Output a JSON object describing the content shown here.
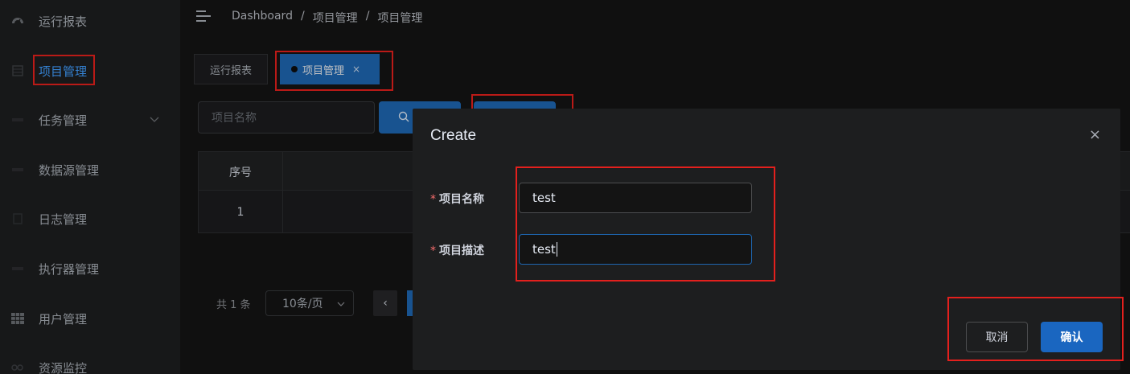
{
  "sidebar": {
    "items": [
      {
        "label": "运行报表",
        "icon": "dashboard-icon"
      },
      {
        "label": "项目管理",
        "icon": "project-icon"
      },
      {
        "label": "任务管理",
        "icon": "task-icon"
      },
      {
        "label": "数据源管理",
        "icon": "database-icon"
      },
      {
        "label": "日志管理",
        "icon": "log-icon"
      },
      {
        "label": "执行器管理",
        "icon": "executor-icon"
      },
      {
        "label": "用户管理",
        "icon": "user-grid-icon"
      },
      {
        "label": "资源监控",
        "icon": "monitor-icon"
      }
    ],
    "active_index": 1
  },
  "header": {
    "breadcrumb": [
      "Dashboard",
      "项目管理",
      "项目管理"
    ],
    "separator": "/"
  },
  "tags": {
    "items": [
      {
        "label": "运行报表"
      },
      {
        "label": "项目管理",
        "close": "×"
      }
    ],
    "active_index": 1
  },
  "toolbar": {
    "search_placeholder": "项目名称"
  },
  "table": {
    "columns": [
      "序号",
      ""
    ],
    "rows": [
      [
        "1",
        ""
      ]
    ]
  },
  "pagination": {
    "total": "共 1 条",
    "page_size": "10条/页",
    "prev": "‹"
  },
  "dialog": {
    "title": "Create",
    "close": "×",
    "fields": [
      {
        "label": "项目名称",
        "value": "test",
        "required": "*"
      },
      {
        "label": "项目描述",
        "value": "test",
        "required": "*"
      }
    ],
    "cancel_label": "取消",
    "confirm_label": "确认"
  },
  "colors": {
    "accent": "#1e66b0",
    "highlight_box": "#e3201d",
    "background": "#141414"
  }
}
